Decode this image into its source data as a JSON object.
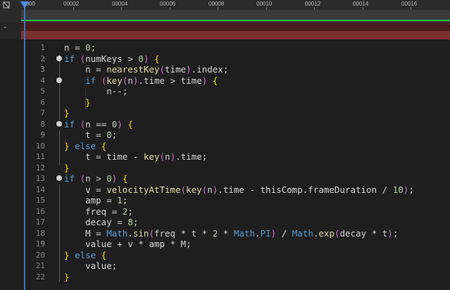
{
  "timeline": {
    "ticks": [
      "0000",
      "00002",
      "00004",
      "00006",
      "00008",
      "00010",
      "00012",
      "00014",
      "00016"
    ]
  },
  "editor": {
    "lines": [
      {
        "n": "1",
        "text": "n = 0;"
      },
      {
        "n": "2",
        "text": "if (numKeys > 0) {"
      },
      {
        "n": "3",
        "text": "    n = nearestKey(time).index;"
      },
      {
        "n": "4",
        "text": "    if (key(n).time > time) {"
      },
      {
        "n": "5",
        "text": "        n--;"
      },
      {
        "n": "6",
        "text": "    }"
      },
      {
        "n": "7",
        "text": "}"
      },
      {
        "n": "8",
        "text": "if (n == 0) {"
      },
      {
        "n": "9",
        "text": "    t = 0;"
      },
      {
        "n": "10",
        "text": "} else {"
      },
      {
        "n": "11",
        "text": "    t = time - key(n).time;"
      },
      {
        "n": "12",
        "text": "}"
      },
      {
        "n": "13",
        "text": "if (n > 0) {"
      },
      {
        "n": "14",
        "text": "    v = velocityAtTime(key(n).time - thisComp.frameDuration / 10);"
      },
      {
        "n": "15",
        "text": "    amp = 1;"
      },
      {
        "n": "16",
        "text": "    freq = 2;"
      },
      {
        "n": "17",
        "text": "    decay = 8;"
      },
      {
        "n": "18",
        "text": "    M = Math.sin(freq * t * 2 * Math.PI) / Math.exp(decay * t);"
      },
      {
        "n": "19",
        "text": "    value + v * amp * M;"
      },
      {
        "n": "20",
        "text": "} else {"
      },
      {
        "n": "21",
        "text": "    value;"
      },
      {
        "n": "22",
        "text": "}"
      }
    ]
  },
  "colors": {
    "playhead": "#4a8ee6",
    "work_area_line": "#2db84a",
    "keyword": "#569cd6",
    "function": "#dcdcaa",
    "number": "#b5cea8"
  },
  "icons": {
    "corner": "composition-icon",
    "chevron": "chevron-down-icon",
    "fold": "fold-marker-icon"
  }
}
